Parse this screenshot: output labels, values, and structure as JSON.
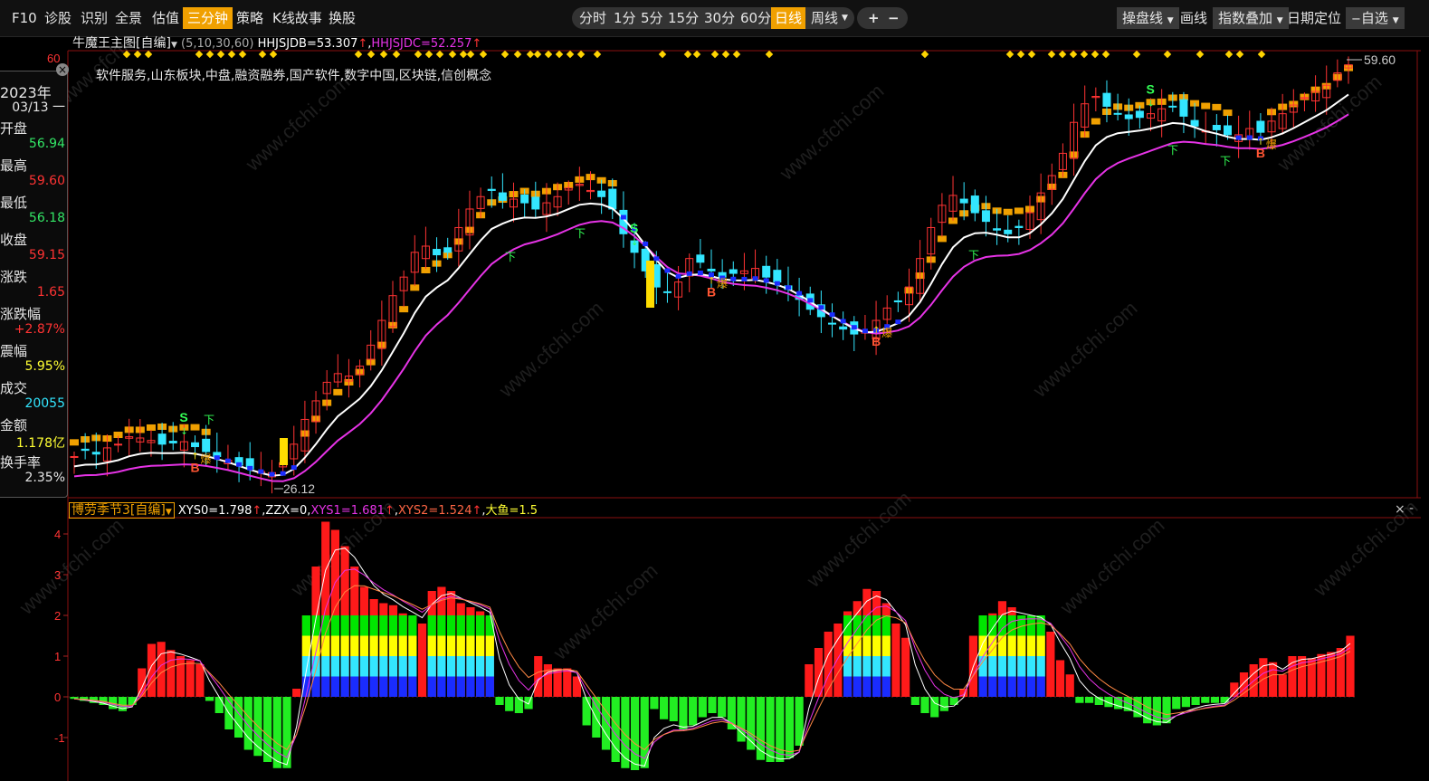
{
  "toolbar": {
    "left_items": [
      "F10",
      "诊股",
      "识别",
      "全景",
      "估值",
      "三分钟",
      "策略",
      "K线故事",
      "换股"
    ],
    "active_left": "三分钟",
    "periods": [
      "分时",
      "1分",
      "5分",
      "15分",
      "30分",
      "60分",
      "日线",
      "周线"
    ],
    "active_period": "日线",
    "zoom_in": "+",
    "zoom_out": "−",
    "right_items": {
      "operate_line": "操盘线",
      "draw": "画线",
      "index_overlay": "指数叠加",
      "date_locate": "日期定位",
      "watchlist": "自选"
    }
  },
  "main_chart": {
    "indicator_name": "牛魔王主图[自编]",
    "params": "(5,10,30,60)",
    "hhjsjdb": "HHJSJDB=53.307",
    "hhjsjdc": "HHJSJDC=52.257",
    "concepts": "软件服务,山东板块,中盘,融资融券,国产软件,数字中国,区块链,信创概念",
    "y_axis_top": "60",
    "high_label": "59.60",
    "low_label": "26.12",
    "signal_labels": {
      "sell": "S",
      "buy": "B",
      "down": "下",
      "burst": "爆"
    }
  },
  "info_panel": {
    "year": "2023年",
    "date": "03/13 一",
    "rows": [
      {
        "label": "开盘",
        "value": "56.94",
        "color": "#33e666"
      },
      {
        "label": "最高",
        "value": "59.60",
        "color": "#ff3333"
      },
      {
        "label": "最低",
        "value": "56.18",
        "color": "#33e666"
      },
      {
        "label": "收盘",
        "value": "59.15",
        "color": "#ff3333"
      },
      {
        "label": "涨跌",
        "value": "1.65",
        "color": "#ff3333"
      },
      {
        "label": "涨跌幅",
        "value": "+2.87%",
        "color": "#ff3333"
      },
      {
        "label": "震幅",
        "value": "5.95%",
        "color": "#ffff33"
      },
      {
        "label": "成交",
        "value": "20055",
        "color": "#33e6ff"
      },
      {
        "label": "金额",
        "value": "1.178亿",
        "color": "#ffff33"
      },
      {
        "label": "换手率",
        "value": "2.35%",
        "color": "#e6e6e6"
      }
    ]
  },
  "sub_chart": {
    "indicator_name": "博劳季节3[自编]",
    "xys0": "XYS0=1.798",
    "zzx": ",ZZX=0,",
    "xys1": "XYS1=1.681",
    "xys2": "XYS2=1.524",
    "dayu": "大鱼=1.5",
    "y_ticks": [
      "4",
      "3",
      "2",
      "1",
      "0",
      "-1"
    ],
    "close": "×",
    "minimize": "-"
  },
  "watermark": "www.cfchi.com",
  "colors": {
    "up": "#ff3333",
    "down": "#33e6ff",
    "ma_white": "#ffffff",
    "ma_magenta": "#e633e6",
    "orange": "#f0a000",
    "green": "#00ff00",
    "yellow": "#ffff00",
    "blue": "#2233ff",
    "cyan": "#33e6ff"
  },
  "chart_data": {
    "type": "candlestick",
    "y_top_label": 60,
    "high": 59.6,
    "low": 26.12,
    "close_trend": [
      27.5,
      28,
      27.7,
      28.2,
      28.5,
      29.1,
      29,
      28.8,
      28.5,
      28.6,
      28.7,
      28.3,
      27.9,
      27.5,
      27.2,
      26.8,
      26.5,
      26.3,
      26.2,
      27.0,
      28.5,
      30.5,
      32,
      33.5,
      34.2,
      34,
      34.8,
      36.5,
      38.5,
      40.5,
      42,
      44,
      44.5,
      43.8,
      44,
      46,
      47.5,
      48.5,
      49,
      48.2,
      48.3,
      48,
      47.5,
      48,
      48.5,
      49.2,
      49.5,
      49,
      48.5,
      47.5,
      45.5,
      44,
      42.5,
      41.2,
      40.8,
      41.6,
      43.5,
      43.2,
      42.5,
      42,
      42.3,
      42.5,
      42.7,
      42,
      41.6,
      41,
      40.2,
      39.4,
      38.8,
      38.2,
      37.8,
      37.4,
      37.6,
      38.5,
      39.5,
      40,
      41.2,
      43.5,
      46,
      47.8,
      48.6,
      48,
      47.2,
      46.5,
      45.8,
      45.5,
      46,
      47.2,
      48.8,
      50.2,
      52,
      54.5,
      56,
      56.6,
      55.8,
      55.2,
      54.8,
      54.9,
      55.2,
      55.6,
      55.8,
      55,
      54.2,
      53.8,
      53.9,
      53.5,
      53.5,
      54,
      53.7,
      54.6,
      55.2,
      55.9,
      56.5,
      57,
      57.5,
      58.5,
      59.15
    ],
    "signals": [
      {
        "type": "S",
        "index": 10
      },
      {
        "type": "B",
        "index": 11
      },
      {
        "type": "S",
        "index": 51
      },
      {
        "type": "B",
        "index": 58
      },
      {
        "type": "B",
        "index": 73
      },
      {
        "type": "S",
        "index": 98
      },
      {
        "type": "B",
        "index": 108
      }
    ],
    "sub_series": {
      "name": "XYS0",
      "values": [
        -0.05,
        -0.1,
        -0.15,
        -0.2,
        -0.3,
        -0.35,
        -0.2,
        0.7,
        1.3,
        1.35,
        1.15,
        1.0,
        0.9,
        0.8,
        -0.1,
        -0.4,
        -0.8,
        -1.0,
        -1.3,
        -1.45,
        -1.6,
        -1.75,
        -1.75,
        0.2,
        2.0,
        3.2,
        4.3,
        4.1,
        3.7,
        3.2,
        2.7,
        2.4,
        2.3,
        2.25,
        2.05,
        1.95,
        1.8,
        2.6,
        2.7,
        2.6,
        2.3,
        2.2,
        2.1,
        1.95,
        -0.2,
        -0.35,
        -0.4,
        -0.3,
        1.0,
        0.8,
        0.7,
        0.7,
        0.5,
        -0.7,
        -1.0,
        -1.3,
        -1.6,
        -1.75,
        -1.8,
        -1.75,
        -0.3,
        -0.55,
        -0.6,
        -0.8,
        -0.7,
        -0.5,
        -0.4,
        -0.5,
        -0.8,
        -1.1,
        -1.3,
        -1.55,
        -1.6,
        -1.6,
        -1.5,
        -1.2,
        0.8,
        1.2,
        1.6,
        1.8,
        2.1,
        2.35,
        2.65,
        2.6,
        2.3,
        1.8,
        1.45,
        -0.2,
        -0.4,
        -0.5,
        -0.35,
        -0.2,
        0.2,
        1.5,
        1.9,
        2.05,
        2.35,
        2.2,
        2.0,
        1.95,
        1.9,
        1.6,
        0.9,
        0.55,
        -0.15,
        -0.15,
        -0.2,
        -0.25,
        -0.3,
        -0.35,
        -0.5,
        -0.65,
        -0.7,
        -0.65,
        -0.3,
        -0.25,
        -0.2,
        -0.15,
        -0.15,
        -0.15,
        0.35,
        0.6,
        0.8,
        0.95,
        0.85,
        0.55,
        1.0,
        1.0,
        0.95,
        1.05,
        1.1,
        1.2,
        1.5
      ]
    }
  }
}
